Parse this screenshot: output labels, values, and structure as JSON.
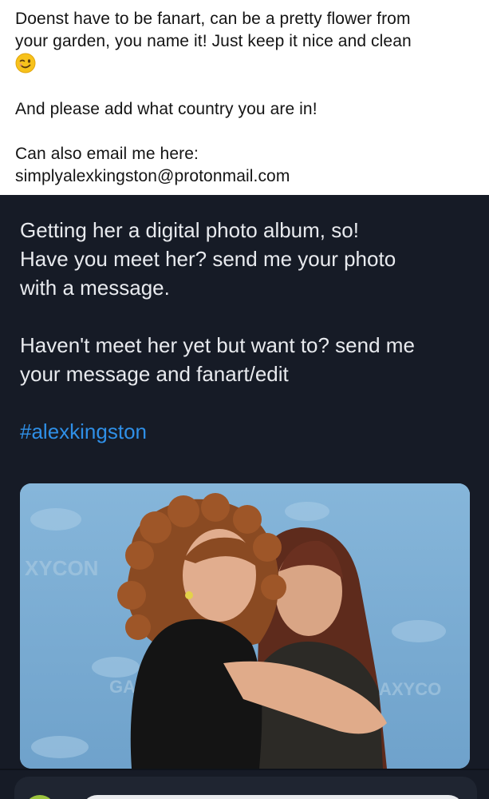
{
  "note": {
    "line1": "Doenst have to be fanart, can be a pretty flower from",
    "line2": "your garden, you name it! Just keep it nice and clean",
    "emoji": "wink-emoji",
    "line3": "And please add what country you are in!",
    "line4": "Can also email me here:",
    "email": "simplyalexkingston@protonmail.com"
  },
  "tweet": {
    "line1": "Getting her a digital photo album, so!",
    "line2": "Have you meet her? send me your photo",
    "line3": "with a message.",
    "line4": "Haven't meet her yet but want to? send me",
    "line5": "your message and fanart/edit",
    "hashtag": "#alexkingston",
    "hashtag_color": "#2f8fe6",
    "background_color": "#161b26",
    "photo_watermark_1": "XYCON",
    "photo_watermark_2": "GAL",
    "photo_watermark_3": "AXYCO"
  },
  "reply": {
    "avatar": "user-avatar"
  }
}
